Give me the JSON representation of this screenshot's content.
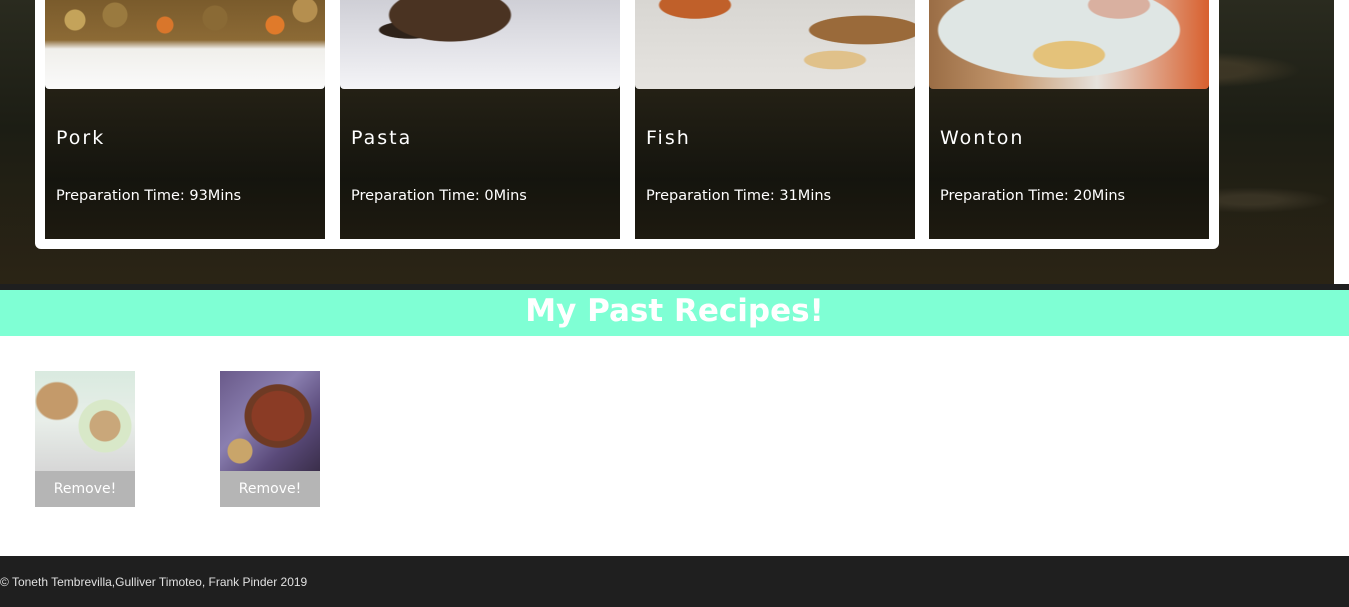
{
  "recipes": [
    {
      "name": "Pork",
      "prep": "Preparation Time: 93Mins",
      "icon": "pork-dish-photo"
    },
    {
      "name": "Pasta",
      "prep": "Preparation Time: 0Mins",
      "icon": "pasta-dish-photo"
    },
    {
      "name": "Fish",
      "prep": "Preparation Time: 31Mins",
      "icon": "fish-dish-photo"
    },
    {
      "name": "Wonton",
      "prep": "Preparation Time: 20Mins",
      "icon": "wonton-dish-photo"
    }
  ],
  "past": {
    "title": "My Past Recipes!",
    "items": [
      {
        "remove_label": "Remove!",
        "icon": "soup-and-bread-photo"
      },
      {
        "remove_label": "Remove!",
        "icon": "roast-beef-photo"
      }
    ]
  },
  "footer": {
    "text": "© Toneth Tembrevilla,Gulliver Timoteo, Frank Pinder 2019"
  },
  "colors": {
    "banner": "#7fffd4",
    "footer_bg": "#1f1f1f",
    "remove_button": "#b5b5b5"
  }
}
